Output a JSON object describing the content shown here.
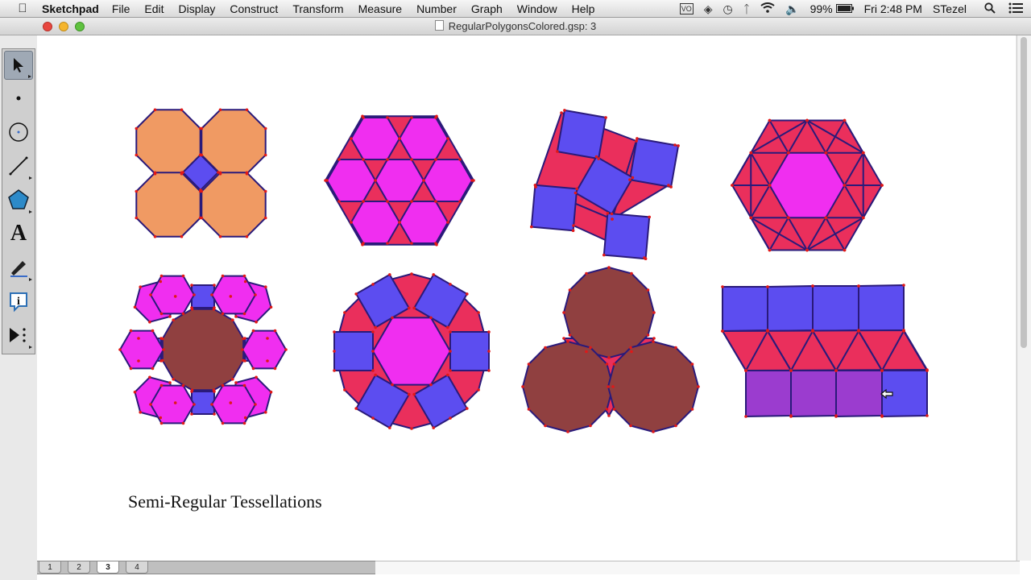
{
  "menubar": {
    "app_name": "Sketchpad",
    "menus": [
      "File",
      "Edit",
      "Display",
      "Construct",
      "Transform",
      "Measure",
      "Number",
      "Graph",
      "Window",
      "Help"
    ],
    "battery": "99%",
    "clock": "Fri 2:48 PM",
    "user": "STezel"
  },
  "window": {
    "title": "RegularPolygonsColored.gsp: 3"
  },
  "toolbox": {
    "tools": [
      "selection-arrow",
      "point",
      "compass",
      "straightedge",
      "polygon",
      "text",
      "marker",
      "information",
      "custom"
    ],
    "text_tool_glyph": "A"
  },
  "canvas": {
    "caption": "Semi-Regular Tessellations"
  },
  "page_tabs": {
    "tabs": [
      "1",
      "2",
      "3",
      "4"
    ],
    "active": "3"
  },
  "colors": {
    "orange": "#f09a63",
    "blue": "#5c4df0",
    "magenta": "#f02ef0",
    "red": "#ea2f5c",
    "maroon": "#904040",
    "stroke": "#2a1a7a",
    "vertex": "#e01818"
  }
}
